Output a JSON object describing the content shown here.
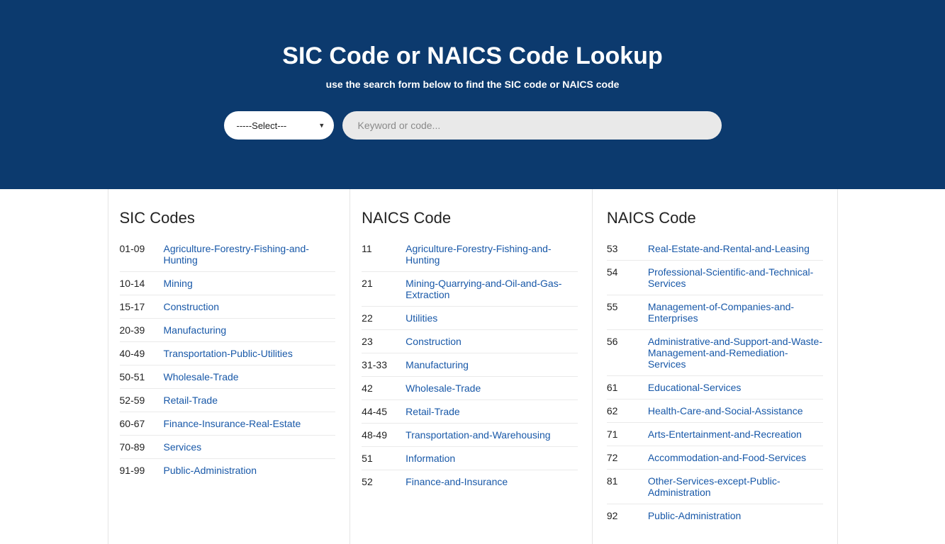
{
  "hero": {
    "title": "SIC Code or NAICS Code Lookup",
    "subtitle": "use the search form below to find the SIC code or NAICS code"
  },
  "search": {
    "select_label": "-----Select---",
    "placeholder": "Keyword or code..."
  },
  "columns": [
    {
      "heading": "SIC Codes",
      "rows": [
        {
          "code": "01-09",
          "label": "Agriculture-Forestry-Fishing-and-Hunting"
        },
        {
          "code": "10-14",
          "label": "Mining"
        },
        {
          "code": "15-17",
          "label": "Construction"
        },
        {
          "code": "20-39",
          "label": "Manufacturing"
        },
        {
          "code": "40-49",
          "label": "Transportation-Public-Utilities"
        },
        {
          "code": "50-51",
          "label": "Wholesale-Trade"
        },
        {
          "code": "52-59",
          "label": "Retail-Trade"
        },
        {
          "code": "60-67",
          "label": "Finance-Insurance-Real-Estate"
        },
        {
          "code": "70-89",
          "label": "Services"
        },
        {
          "code": "91-99",
          "label": "Public-Administration"
        }
      ]
    },
    {
      "heading": "NAICS Code",
      "rows": [
        {
          "code": "11",
          "label": "Agriculture-Forestry-Fishing-and-Hunting"
        },
        {
          "code": "21",
          "label": "Mining-Quarrying-and-Oil-and-Gas-Extraction"
        },
        {
          "code": "22",
          "label": "Utilities"
        },
        {
          "code": "23",
          "label": "Construction"
        },
        {
          "code": "31-33",
          "label": "Manufacturing"
        },
        {
          "code": "42",
          "label": "Wholesale-Trade"
        },
        {
          "code": "44-45",
          "label": "Retail-Trade"
        },
        {
          "code": "48-49",
          "label": "Transportation-and-Warehousing"
        },
        {
          "code": "51",
          "label": "Information"
        },
        {
          "code": "52",
          "label": "Finance-and-Insurance"
        }
      ]
    },
    {
      "heading": "NAICS Code",
      "rows": [
        {
          "code": "53",
          "label": "Real-Estate-and-Rental-and-Leasing"
        },
        {
          "code": "54",
          "label": "Professional-Scientific-and-Technical-Services"
        },
        {
          "code": "55",
          "label": "Management-of-Companies-and-Enterprises"
        },
        {
          "code": "56",
          "label": "Administrative-and-Support-and-Waste-Management-and-Remediation-Services"
        },
        {
          "code": "61",
          "label": "Educational-Services"
        },
        {
          "code": "62",
          "label": "Health-Care-and-Social-Assistance"
        },
        {
          "code": "71",
          "label": "Arts-Entertainment-and-Recreation"
        },
        {
          "code": "72",
          "label": "Accommodation-and-Food-Services"
        },
        {
          "code": "81",
          "label": "Other-Services-except-Public-Administration"
        },
        {
          "code": "92",
          "label": "Public-Administration"
        }
      ]
    }
  ]
}
